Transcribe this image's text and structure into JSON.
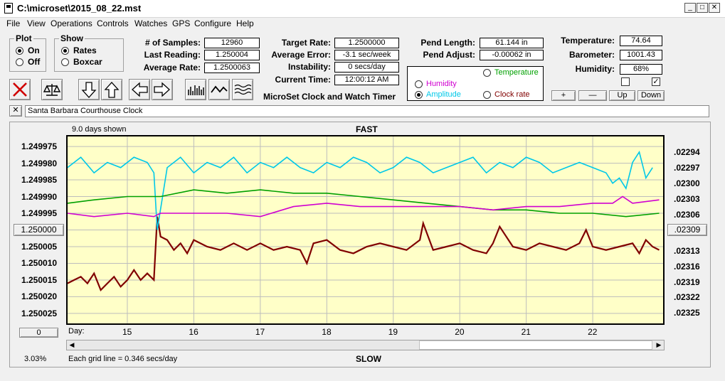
{
  "window": {
    "title": "C:\\microset\\2015_08_22.mst"
  },
  "menu": [
    "File",
    "View",
    "Operations",
    "Controls",
    "Watches",
    "GPS",
    "Configure",
    "Help"
  ],
  "plot_group": {
    "title": "Plot",
    "on_label": "On",
    "off_label": "Off",
    "selected": "On"
  },
  "show_group": {
    "title": "Show",
    "rates_label": "Rates",
    "boxcar_label": "Boxcar",
    "selected": "Rates"
  },
  "stats": {
    "samples_label": "# of Samples:",
    "samples": "12960",
    "last_reading_label": "Last Reading:",
    "last_reading": "1.250004",
    "average_rate_label": "Average Rate:",
    "average_rate": "1.2500063",
    "target_rate_label": "Target Rate:",
    "target_rate": "1.2500000",
    "average_error_label": "Average Error:",
    "average_error": "-3.1 sec/week",
    "instability_label": "Instability:",
    "instability": "0 secs/day",
    "current_time_label": "Current Time:",
    "current_time": "12:00:12 AM",
    "app_label": "MicroSet Clock and Watch Timer",
    "pend_length_label": "Pend Length:",
    "pend_length": "61.144 in",
    "pend_adjust_label": "Pend Adjust:",
    "pend_adjust": "-0.00062 in",
    "temperature_label": "Temperature:",
    "temperature": "74.64",
    "barometer_label": "Barometer:",
    "barometer": "1001.43",
    "humidity_label": "Humidity:",
    "humidity": "68%"
  },
  "series_options": {
    "temperature": "Temperature",
    "humidity": "Humidity",
    "amplitude": "Amplitude",
    "clock_rate": "Clock rate",
    "selected": "Amplitude",
    "colors": {
      "temperature": "#00a000",
      "humidity": "#d000d0",
      "amplitude": "#00c8e8",
      "clock_rate": "#800000"
    }
  },
  "checkboxes": [
    {
      "checked": false
    },
    {
      "checked": true
    }
  ],
  "small_buttons": {
    "plus": "+",
    "minus": "—",
    "up": "Up",
    "down": "Down"
  },
  "clock_name": "Santa Barbara Courthouse Clock",
  "chart_labels": {
    "days_shown": "9.0 days shown",
    "top": "FAST",
    "bottom": "SLOW",
    "day_label": "Day:",
    "grid_note": "Each grid line = 0.346 secs/day",
    "percent": "3.03%",
    "left_button": "1.250000",
    "right_button": ".02309",
    "zero_button": "0"
  },
  "chart_data": {
    "type": "line",
    "x_label": "Day:",
    "x_ticks": [
      15,
      16,
      17,
      18,
      19,
      20,
      21,
      22
    ],
    "xlim": [
      14.08,
      23.08
    ],
    "ylim_left": [
      1.249972,
      1.250028
    ],
    "ylim_right": [
      0.02291,
      0.02327
    ],
    "y_ticks_left": [
      "1.249975",
      "1.249980",
      "1.249985",
      "1.249990",
      "1.249995",
      "1.250000",
      "1.250005",
      "1.250010",
      "1.250015",
      "1.250020",
      "1.250025"
    ],
    "y_ticks_right": [
      ".02294",
      ".02297",
      ".02300",
      ".02303",
      ".02306",
      ".02309",
      ".02313",
      ".02316",
      ".02319",
      ".02322",
      ".02325"
    ],
    "series": [
      {
        "name": "Clock rate",
        "axis": "left",
        "color": "#800000",
        "x": [
          14.1,
          14.2,
          14.3,
          14.4,
          14.5,
          14.6,
          14.7,
          14.8,
          14.9,
          15.0,
          15.1,
          15.2,
          15.3,
          15.4,
          15.45,
          15.5,
          15.6,
          15.7,
          15.8,
          15.9,
          16.0,
          16.2,
          16.4,
          16.6,
          16.8,
          17.0,
          17.2,
          17.4,
          17.6,
          17.7,
          17.8,
          18.0,
          18.2,
          18.4,
          18.6,
          18.8,
          19.0,
          19.2,
          19.4,
          19.45,
          19.6,
          19.8,
          20.0,
          20.2,
          20.4,
          20.5,
          20.6,
          20.8,
          21.0,
          21.2,
          21.4,
          21.6,
          21.8,
          21.9,
          22.0,
          22.2,
          22.4,
          22.6,
          22.7,
          22.8,
          22.9,
          23.0
        ],
        "y": [
          1.250016,
          1.250015,
          1.250014,
          1.250016,
          1.250013,
          1.250018,
          1.250016,
          1.250014,
          1.250017,
          1.250015,
          1.250012,
          1.250015,
          1.250013,
          1.250015,
          1.249996,
          1.250002,
          1.250003,
          1.250006,
          1.250004,
          1.250007,
          1.250003,
          1.250005,
          1.250006,
          1.250004,
          1.250006,
          1.250004,
          1.250006,
          1.250005,
          1.250006,
          1.25001,
          1.250004,
          1.250003,
          1.250006,
          1.250007,
          1.250005,
          1.250004,
          1.250005,
          1.250006,
          1.250003,
          1.249998,
          1.250006,
          1.250005,
          1.250004,
          1.250006,
          1.250007,
          1.250004,
          1.249999,
          1.250005,
          1.250006,
          1.250004,
          1.250005,
          1.250006,
          1.250004,
          1.25,
          1.250005,
          1.250006,
          1.250005,
          1.250004,
          1.250007,
          1.250003,
          1.250005,
          1.250006
        ]
      },
      {
        "name": "Amplitude",
        "axis": "right",
        "color": "#00c8e8",
        "x": [
          14.1,
          14.3,
          14.5,
          14.7,
          14.9,
          15.1,
          15.3,
          15.4,
          15.45,
          15.6,
          15.8,
          16.0,
          16.2,
          16.4,
          16.6,
          16.8,
          17.0,
          17.2,
          17.4,
          17.6,
          17.8,
          18.0,
          18.2,
          18.4,
          18.6,
          18.8,
          19.0,
          19.2,
          19.4,
          19.6,
          19.8,
          20.0,
          20.2,
          20.4,
          20.6,
          20.8,
          21.0,
          21.2,
          21.4,
          21.6,
          21.8,
          22.0,
          22.2,
          22.3,
          22.4,
          22.5,
          22.6,
          22.7,
          22.8,
          22.9
        ],
        "y": [
          0.02297,
          0.02295,
          0.02298,
          0.02296,
          0.02297,
          0.02295,
          0.02296,
          0.02298,
          0.02309,
          0.02297,
          0.02295,
          0.02298,
          0.02296,
          0.02297,
          0.02295,
          0.02298,
          0.02296,
          0.02297,
          0.02295,
          0.02297,
          0.02298,
          0.02296,
          0.02297,
          0.02295,
          0.02296,
          0.02298,
          0.02297,
          0.02295,
          0.02296,
          0.02298,
          0.02297,
          0.02296,
          0.02295,
          0.02298,
          0.02296,
          0.02297,
          0.02295,
          0.02296,
          0.02298,
          0.02297,
          0.02296,
          0.02297,
          0.02298,
          0.023,
          0.02299,
          0.02301,
          0.02296,
          0.02294,
          0.02299,
          0.02297
        ]
      },
      {
        "name": "Temperature",
        "axis": "left",
        "color": "#00a000",
        "x": [
          14.1,
          14.5,
          15.0,
          15.5,
          16.0,
          16.5,
          17.0,
          17.5,
          18.0,
          18.5,
          19.0,
          19.5,
          20.0,
          20.5,
          21.0,
          21.5,
          22.0,
          22.5,
          23.0
        ],
        "y": [
          1.249992,
          1.249991,
          1.24999,
          1.24999,
          1.249988,
          1.249989,
          1.249988,
          1.249989,
          1.249989,
          1.24999,
          1.249991,
          1.249992,
          1.249993,
          1.249994,
          1.249994,
          1.249995,
          1.249995,
          1.249996,
          1.249995
        ]
      },
      {
        "name": "Humidity",
        "axis": "left",
        "color": "#d000d0",
        "x": [
          14.1,
          14.5,
          15.0,
          15.4,
          15.5,
          16.0,
          16.5,
          17.0,
          17.5,
          18.0,
          18.5,
          19.0,
          19.5,
          20.0,
          20.5,
          21.0,
          21.5,
          22.0,
          22.3,
          22.45,
          22.6,
          23.0
        ],
        "y": [
          1.249995,
          1.249996,
          1.249995,
          1.249996,
          1.249995,
          1.249995,
          1.249995,
          1.249996,
          1.249993,
          1.249992,
          1.249993,
          1.249993,
          1.249993,
          1.249993,
          1.249994,
          1.249993,
          1.249993,
          1.249992,
          1.249992,
          1.24999,
          1.249992,
          1.249991
        ]
      }
    ]
  }
}
